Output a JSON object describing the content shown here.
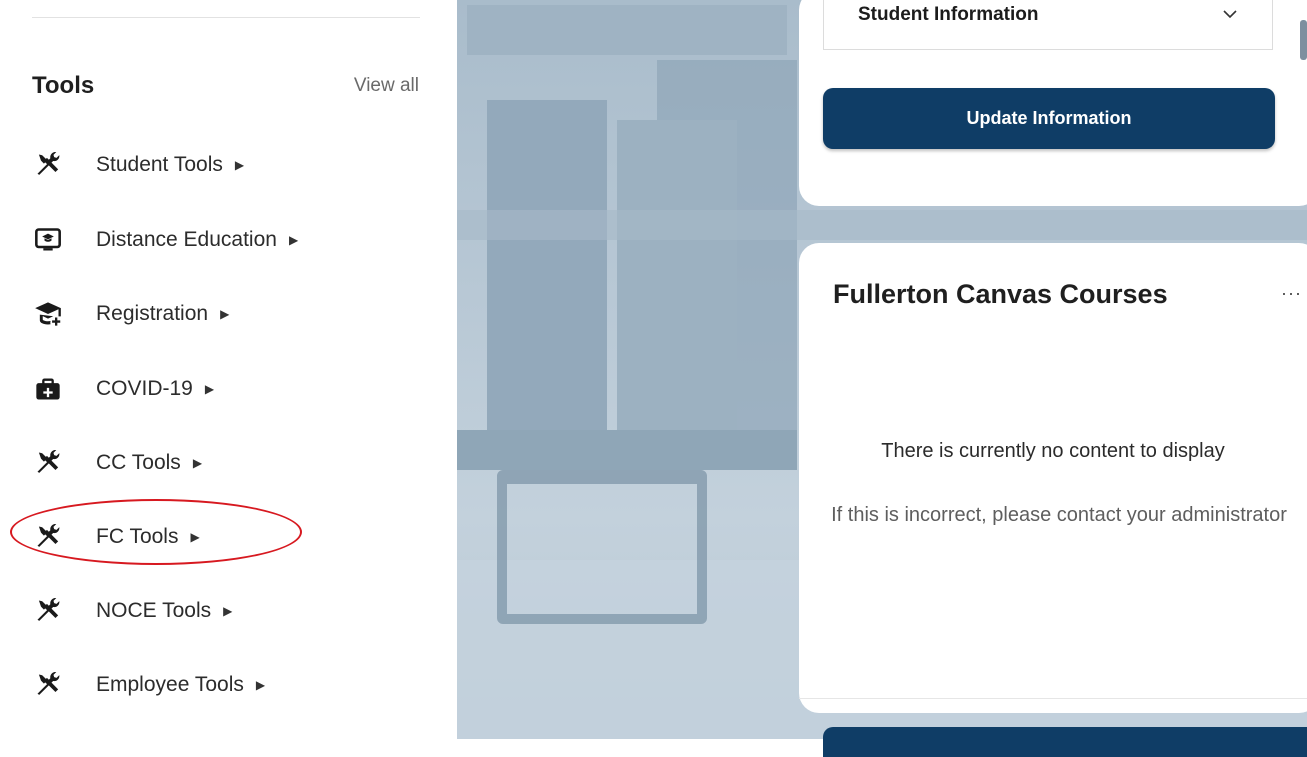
{
  "tools": {
    "title": "Tools",
    "view_all": "View all",
    "items": [
      {
        "label": "Student Tools",
        "icon": "tools-icon"
      },
      {
        "label": "Distance Education",
        "icon": "monitor-graduation-icon"
      },
      {
        "label": "Registration",
        "icon": "graduation-cap-add-icon"
      },
      {
        "label": "COVID-19",
        "icon": "medical-bag-icon"
      },
      {
        "label": "CC Tools",
        "icon": "tools-icon"
      },
      {
        "label": "FC Tools",
        "icon": "tools-icon"
      },
      {
        "label": "NOCE Tools",
        "icon": "tools-icon"
      },
      {
        "label": "Employee Tools",
        "icon": "tools-icon"
      }
    ],
    "highlighted_item": "FC Tools"
  },
  "student_info_card": {
    "select_value": "Student Information",
    "update_button": "Update Information"
  },
  "canvas_card": {
    "title": "Fullerton Canvas Courses",
    "more": "···",
    "empty_message": "There is currently no content to display",
    "empty_sub": "If this is incorrect, please contact your administrator"
  },
  "colors": {
    "primary_button": "#0f3d66",
    "highlight_ring": "#d71920"
  }
}
